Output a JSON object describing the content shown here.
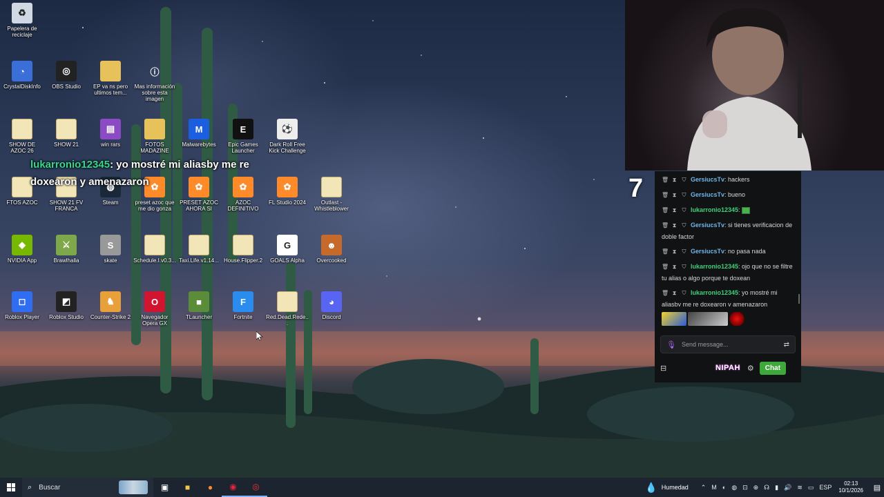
{
  "desktop": {
    "icons": [
      {
        "label": "Papelera de reciclaje",
        "icon": "recycle-bin-icon"
      },
      {
        "label": "CrystalDiskInfo",
        "icon": "crystaldiskinfo-icon"
      },
      {
        "label": "OBS Studio",
        "icon": "obs-icon"
      },
      {
        "label": "EP va ns pero ultimos tem...",
        "icon": "folder-icon"
      },
      {
        "label": "Mas información sobre esta imagen",
        "icon": "info-icon"
      },
      {
        "label": "SHOW DE AZOC 26",
        "icon": "file-icon"
      },
      {
        "label": "SHOW 21",
        "icon": "file-icon"
      },
      {
        "label": "win rars",
        "icon": "winrar-icon"
      },
      {
        "label": "FOTOS MADAZINE",
        "icon": "folder-icon"
      },
      {
        "label": "Malwarebytes",
        "icon": "malwarebytes-icon"
      },
      {
        "label": "Epic Games Launcher",
        "icon": "epic-games-icon"
      },
      {
        "label": "Dark Roll Free Kick Challenge",
        "icon": "soccer-ball-icon"
      },
      {
        "label": "FTOS AZOC",
        "icon": "file-icon"
      },
      {
        "label": "SHOW 21 FV FRANCA",
        "icon": "file-icon"
      },
      {
        "label": "Steam",
        "icon": "steam-icon"
      },
      {
        "label": "preset azoc que me dio gonza",
        "icon": "fl-studio-icon"
      },
      {
        "label": "PRESET AZOC AHORA SI",
        "icon": "fl-studio-icon"
      },
      {
        "label": "AZOC DEFINITIVO",
        "icon": "fl-studio-icon"
      },
      {
        "label": "FL Studio 2024",
        "icon": "fl-studio-icon"
      },
      {
        "label": "Outlast - Whistleblower",
        "icon": "file-icon"
      },
      {
        "label": "NVIDIA App",
        "icon": "nvidia-icon"
      },
      {
        "label": "Brawlhalla",
        "icon": "brawlhalla-icon"
      },
      {
        "label": "skate",
        "icon": "skate-icon"
      },
      {
        "label": "Schedule.I.v0.3...",
        "icon": "file-icon"
      },
      {
        "label": "Taxi.Life.v1.14...",
        "icon": "file-icon"
      },
      {
        "label": "House.Flipper.2",
        "icon": "file-icon"
      },
      {
        "label": "GOALS Alpha",
        "icon": "goals-icon"
      },
      {
        "label": "Overcooked",
        "icon": "overcooked-icon"
      },
      {
        "label": "Roblox Player",
        "icon": "roblox-player-icon"
      },
      {
        "label": "Roblox Studio",
        "icon": "roblox-studio-icon"
      },
      {
        "label": "Counter-Strike 2",
        "icon": "counter-strike-icon"
      },
      {
        "label": "Navegador Opera GX",
        "icon": "opera-gx-icon"
      },
      {
        "label": "TLauncher",
        "icon": "tlauncher-icon"
      },
      {
        "label": "Fortnite",
        "icon": "fortnite-icon"
      },
      {
        "label": "Red.Dead.Rede...",
        "icon": "file-icon"
      },
      {
        "label": "Discord",
        "icon": "discord-icon"
      }
    ]
  },
  "overlay": {
    "user": "lukarronio12345",
    "text": ": yo mostré mi aliasby me re doxearon y amenazaron"
  },
  "stream": {
    "counter": "7"
  },
  "chat": {
    "messages": [
      {
        "user": "GersiucsTv",
        "text": "hackers",
        "color": "blue"
      },
      {
        "user": "GersiucsTv",
        "text": "bueno",
        "color": "blue"
      },
      {
        "user": "lukarronio12345",
        "text": "",
        "color": "green",
        "emote": true
      },
      {
        "user": "GersiucsTv",
        "text": "si tienes verificacion de doble factor",
        "color": "blue"
      },
      {
        "user": "GersiucsTv",
        "text": "no pasa nada",
        "color": "blue"
      },
      {
        "user": "lukarronio12345",
        "text": "ojo que no se filtre tu alias o algo porque te doxean",
        "color": "green"
      },
      {
        "user": "lukarronio12345",
        "text": "yo mostré mi aliasby me re doxearon y amenazaron",
        "color": "green"
      }
    ],
    "input_placeholder": "Send message...",
    "brand": "NIPAH",
    "chat_button": "Chat"
  },
  "taskbar": {
    "search_label": "Buscar",
    "weather": "Humedad",
    "language": "ESP",
    "time": "02:13",
    "date": "10/1/2026"
  },
  "colors": {
    "chat_user_green": "#3fd17a",
    "chat_user_blue": "#6fb6e8",
    "chat_button": "#3ea83a",
    "taskbar": "#1c2430"
  }
}
